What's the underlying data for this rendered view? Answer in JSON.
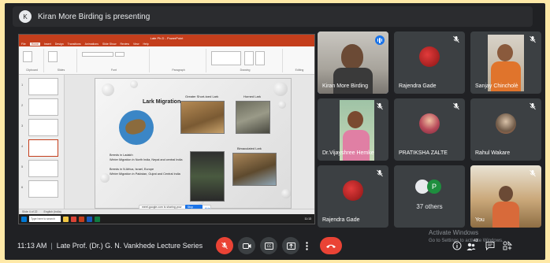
{
  "banner": {
    "text": "Kiran More Birding is presenting",
    "avatar_letter": "K"
  },
  "presentation": {
    "window_title": "Late Ph.D - PowerPoint",
    "tabs": [
      "File",
      "Home",
      "Insert",
      "Design",
      "Transitions",
      "Animations",
      "Slide Show",
      "Review",
      "View",
      "Help"
    ],
    "active_tab": "Home",
    "ribbon_groups": [
      "Clipboard",
      "Slides",
      "Font",
      "Paragraph",
      "Drawing",
      "Editing"
    ],
    "slide": {
      "title": "Lark Migration",
      "captions": [
        "Greater Short-toed Lark",
        "Horned Lark",
        "Bimaculated Lark"
      ],
      "text_block_1": [
        "Breeds in Ladakh",
        "Winter Migration in North India, Nepal and central India"
      ],
      "text_block_2": [
        "Breeds in N Africa, Israel, Europe",
        "Winter Migration in Pakistan, Gujrat and Central India"
      ]
    },
    "share_bar": {
      "text": "meet.google.com is sharing your screen.",
      "stop": "Stop sharing",
      "hide": "Hide"
    },
    "status": [
      "Slide 4 of 22",
      "English (India)"
    ],
    "taskbar": {
      "search": "Type here to search",
      "time": "11:13",
      "date": "21-06-2021"
    }
  },
  "participants": [
    {
      "name": "Kiran More Birding",
      "speaking": true
    },
    {
      "name": "Rajendra Gade",
      "muted": true
    },
    {
      "name": "Sanjay Chincholè",
      "muted": true
    },
    {
      "name": "Dr.Vijayshree Hemke",
      "muted": true
    },
    {
      "name": "PRATIKSHA ZALTE",
      "muted": true
    },
    {
      "name": "Rahul Wakare",
      "muted": true
    },
    {
      "name": "Rajendra Gade",
      "muted": true
    },
    {
      "name": "37 others",
      "avatar_letter": "P"
    },
    {
      "name": "You",
      "muted": true
    }
  ],
  "bottom_bar": {
    "time": "11:13 AM",
    "meeting_title": "Late Prof. (Dr.) G. N. Vankhede Lecture Series",
    "participant_count": "43"
  },
  "watermark": {
    "line1": "Activate Windows",
    "line2": "Go to Settings to activate Windows."
  },
  "colors": {
    "accent": "#8ab4f8",
    "end_call": "#ea4335",
    "tile_bg": "#3c4043",
    "background": "#202124"
  }
}
